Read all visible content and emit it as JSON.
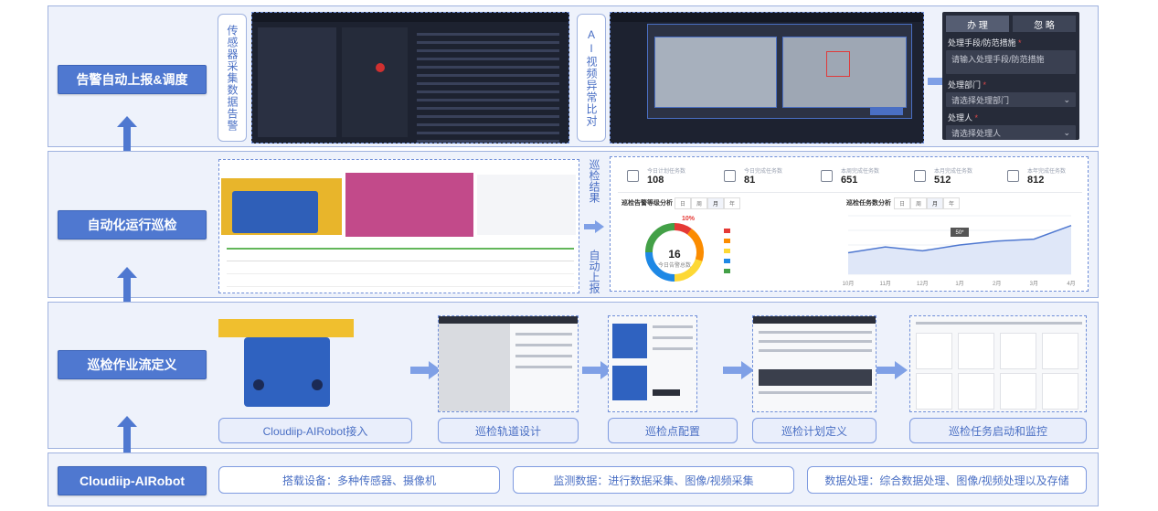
{
  "stages": {
    "alarm": "告警自动上报&调度",
    "inspection": "自动化运行巡检",
    "workflow": "巡检作业流定义",
    "robot": "Cloudiip-AIRobot"
  },
  "alarm_row": {
    "sensor_label": "传感器采集数据告警",
    "ai_label": "AI视频异常比对",
    "form": {
      "tab_handle": "办 理",
      "tab_ignore": "忽 略",
      "measures_label": "处理手段/防范措施",
      "measures_placeholder": "请输入处理手段/防范措施",
      "dept_label": "处理部门",
      "dept_placeholder": "请选择处理部门",
      "person_label": "处理人",
      "person_placeholder": "请选择处理人"
    }
  },
  "inspection_row": {
    "result_label": "巡检结果",
    "auto_report_label": "自动上报",
    "kpis": [
      {
        "label": "今日计划任务数",
        "value": "108"
      },
      {
        "label": "今日完成任务数",
        "value": "81"
      },
      {
        "label": "本周完成任务数",
        "value": "651"
      },
      {
        "label": "本月完成任务数",
        "value": "512"
      },
      {
        "label": "本年完成任务数",
        "value": "812"
      }
    ],
    "alarm_chart": {
      "title": "巡检告警等级分析",
      "tabs": [
        "日",
        "周",
        "月",
        "年"
      ],
      "center_value": "16",
      "center_label": "今日告警总数",
      "top_percent": "10%"
    },
    "task_chart": {
      "title": "巡检任务数分析",
      "tabs": [
        "日",
        "周",
        "月",
        "年"
      ],
      "tooltip": "50*",
      "x_labels": [
        "10月",
        "11月",
        "12月",
        "1月",
        "2月",
        "3月",
        "4月"
      ]
    }
  },
  "workflow_row": {
    "steps": [
      "Cloudiip-AIRobot接入",
      "巡检轨道设计",
      "巡检点配置",
      "巡检计划定义",
      "巡检任务启动和监控"
    ]
  },
  "robot_row": {
    "items": [
      "搭载设备：多种传感器、摄像机",
      "监测数据：进行数据采集、图像/视频采集",
      "数据处理：综合数据处理、图像/视频处理以及存储"
    ]
  },
  "chart_data": [
    {
      "type": "pie",
      "title": "巡检告警等级分析",
      "center_value": 16,
      "center_label": "今日告警总数",
      "annotation": "10%",
      "slices": [
        {
          "value": 10,
          "color": "#e53935"
        },
        {
          "value": 20,
          "color": "#fb8c00"
        },
        {
          "value": 20,
          "color": "#fdd835"
        },
        {
          "value": 25,
          "color": "#1e88e5"
        },
        {
          "value": 25,
          "color": "#43a047"
        }
      ]
    },
    {
      "type": "area",
      "title": "巡检任务数分析",
      "x": [
        "10月",
        "11月",
        "12月",
        "1月",
        "2月",
        "3月",
        "4月"
      ],
      "values": [
        22,
        28,
        24,
        30,
        34,
        36,
        50
      ],
      "ylim": [
        0,
        60
      ],
      "annotation": "50*",
      "color": "#4f78d0"
    }
  ]
}
